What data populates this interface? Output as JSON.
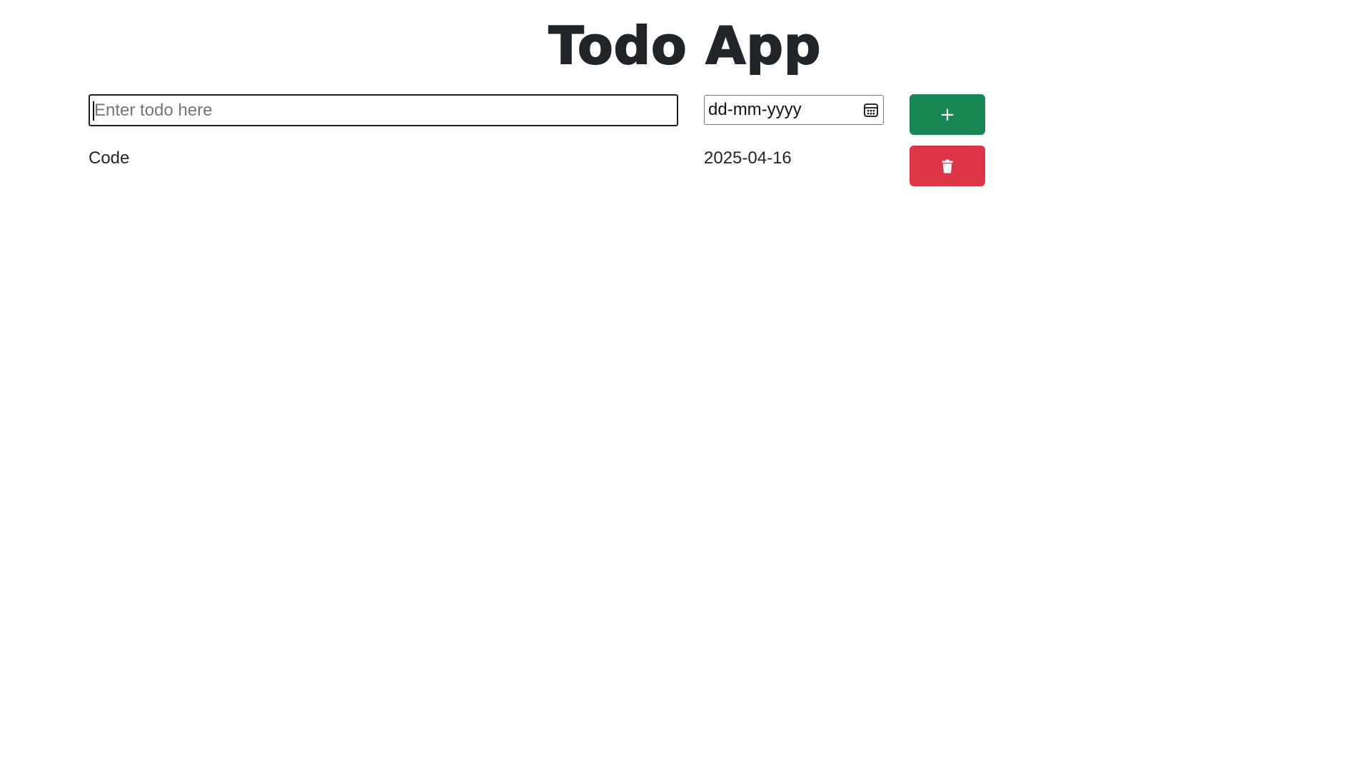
{
  "app": {
    "title": "Todo App"
  },
  "form": {
    "todo_input": {
      "placeholder": "Enter todo here",
      "value": ""
    },
    "date_input": {
      "placeholder": "dd-mm-yyyy"
    },
    "add_button": {
      "label": "+",
      "color": "#198754"
    }
  },
  "todos": [
    {
      "name": "Code",
      "date": "2025-04-16",
      "delete_button_color": "#dc3545"
    }
  ],
  "icons": {
    "calendar": "calendar-icon",
    "delete": "trash-icon"
  }
}
